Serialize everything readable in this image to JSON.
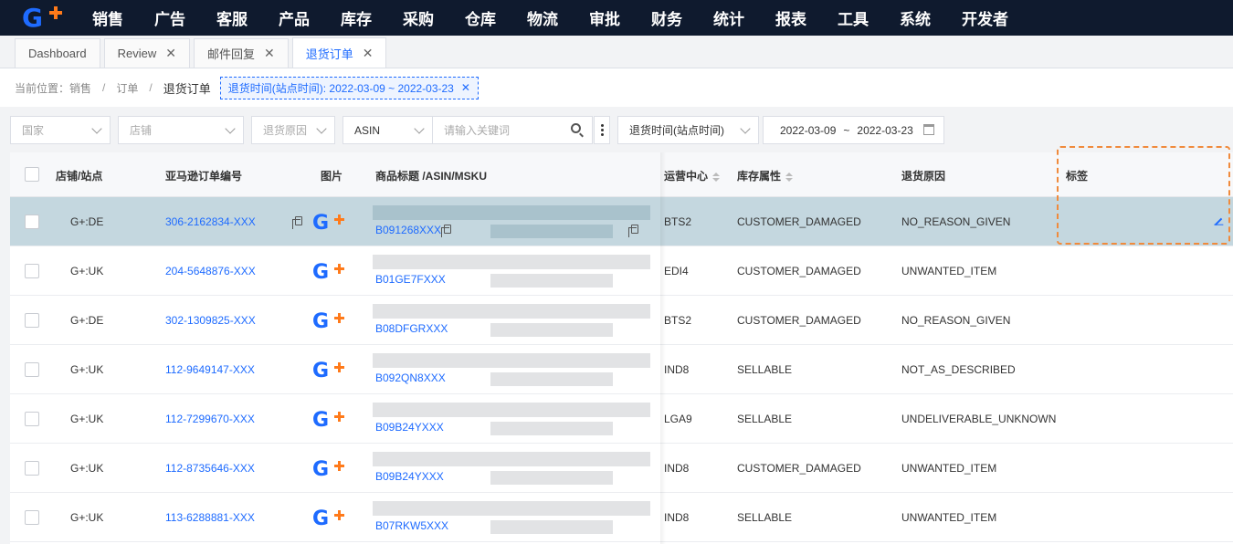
{
  "nav": [
    "销售",
    "广告",
    "客服",
    "产品",
    "库存",
    "采购",
    "仓库",
    "物流",
    "审批",
    "财务",
    "统计",
    "报表",
    "工具",
    "系统",
    "开发者"
  ],
  "tabs": [
    {
      "label": "Dashboard",
      "closable": false,
      "active": false
    },
    {
      "label": "Review",
      "closable": true,
      "active": false
    },
    {
      "label": "邮件回复",
      "closable": true,
      "active": false
    },
    {
      "label": "退货订单",
      "closable": true,
      "active": true
    }
  ],
  "breadcrumb": {
    "prefix": "当前位置：",
    "items": [
      "销售",
      "订单",
      "退货订单"
    ],
    "filter_chip": "退货时间(站点时间): 2022-03-09 ~ 2022-03-23"
  },
  "filters": {
    "country": "国家",
    "store": "店铺",
    "reason": "退货原因",
    "asin_select": "ASIN",
    "keyword_placeholder": "请输入关键词",
    "time_type": "退货时间(站点时间)",
    "date_start": "2022-03-09",
    "date_sep": "~",
    "date_end": "2022-03-23"
  },
  "columns": {
    "store": "店铺/站点",
    "order_no": "亚马逊订单编号",
    "image": "图片",
    "title": "商品标题 /ASIN/MSKU",
    "fc": "运营中心",
    "inventory": "库存属性",
    "reason": "退货原因",
    "tag": "标签"
  },
  "rows": [
    {
      "store": "G+:DE",
      "order": "306-2162834-XXX",
      "asin": "B091268XXX",
      "fc": "BTS2",
      "inventory": "CUSTOMER_DAMAGED",
      "reason": "NO_REASON_GIVEN",
      "selected": true
    },
    {
      "store": "G+:UK",
      "order": "204-5648876-XXX",
      "asin": "B01GE7FXXX",
      "fc": "EDI4",
      "inventory": "CUSTOMER_DAMAGED",
      "reason": "UNWANTED_ITEM",
      "selected": false
    },
    {
      "store": "G+:DE",
      "order": "302-1309825-XXX",
      "asin": "B08DFGRXXX",
      "fc": "BTS2",
      "inventory": "CUSTOMER_DAMAGED",
      "reason": "NO_REASON_GIVEN",
      "selected": false
    },
    {
      "store": "G+:UK",
      "order": "112-9649147-XXX",
      "asin": "B092QN8XXX",
      "fc": "IND8",
      "inventory": "SELLABLE",
      "reason": "NOT_AS_DESCRIBED",
      "selected": false
    },
    {
      "store": "G+:UK",
      "order": "112-7299670-XXX",
      "asin": "B09B24YXXX",
      "fc": "LGA9",
      "inventory": "SELLABLE",
      "reason": "UNDELIVERABLE_UNKNOWN",
      "selected": false
    },
    {
      "store": "G+:UK",
      "order": "112-8735646-XXX",
      "asin": "B09B24YXXX",
      "fc": "IND8",
      "inventory": "CUSTOMER_DAMAGED",
      "reason": "UNWANTED_ITEM",
      "selected": false
    },
    {
      "store": "G+:UK",
      "order": "113-6288881-XXX",
      "asin": "B07RKW5XXX",
      "fc": "IND8",
      "inventory": "SELLABLE",
      "reason": "UNWANTED_ITEM",
      "selected": false
    }
  ],
  "colors": {
    "nav_bg": "#0f1a2e",
    "accent": "#1e6bff",
    "brand_orange": "#ff7a1a",
    "selected_row": "#c4d7df",
    "highlight": "#f08a3c"
  }
}
